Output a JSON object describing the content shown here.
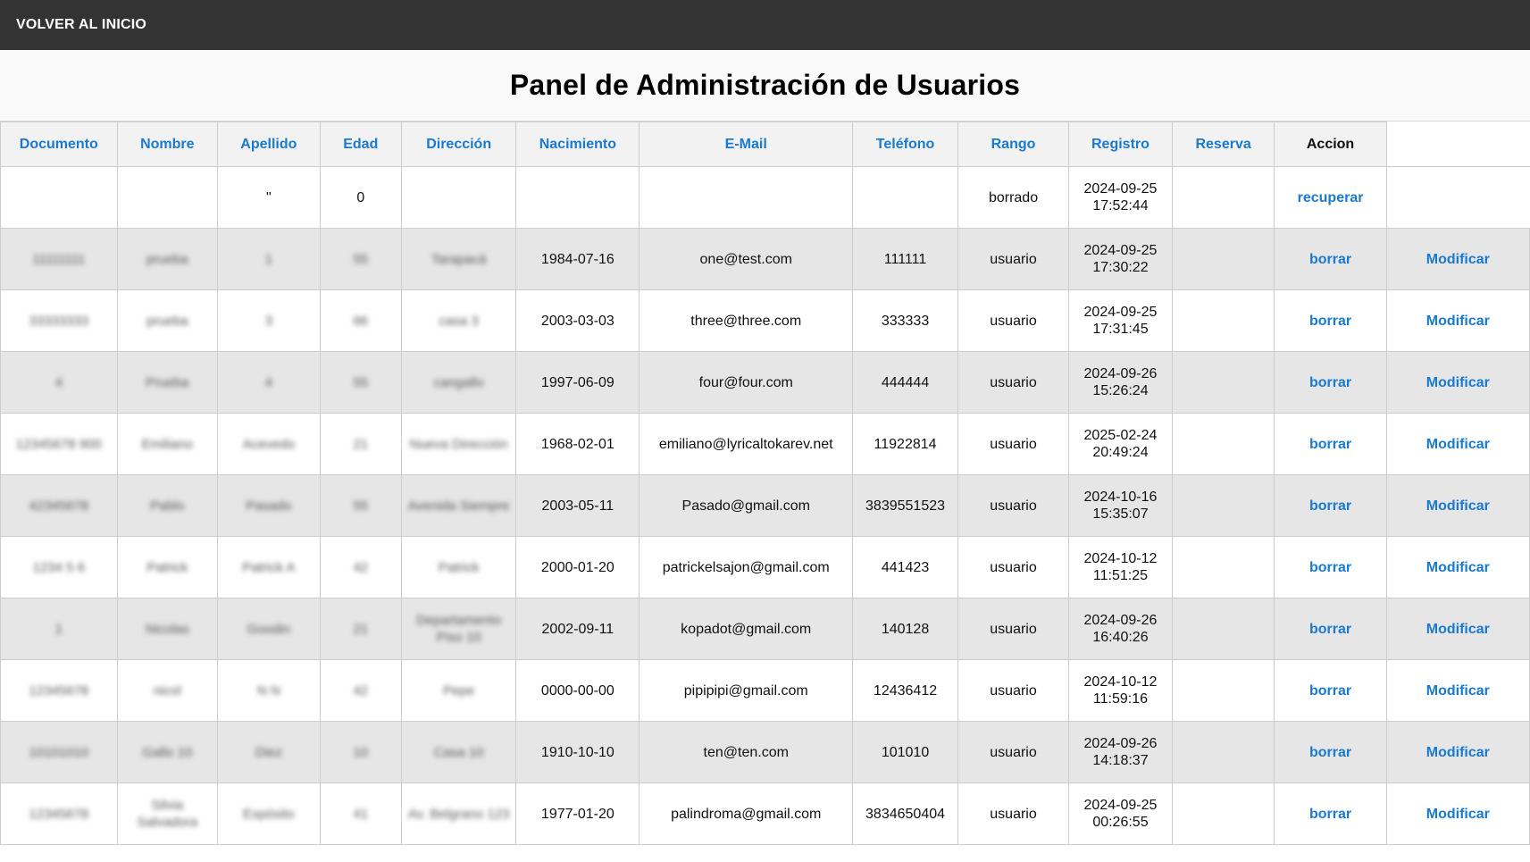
{
  "nav": {
    "back_label": "VOLVER AL INICIO"
  },
  "page": {
    "title": "Panel de Administración de Usuarios"
  },
  "table": {
    "headers": [
      "Documento",
      "Nombre",
      "Apellido",
      "Edad",
      "Dirección",
      "Nacimiento",
      "E-Mail",
      "Teléfono",
      "Rango",
      "Registro",
      "Reserva",
      "Accion"
    ],
    "rows": [
      {
        "documento": "",
        "nombre": "",
        "apellido": "\"",
        "edad": "0",
        "direccion": "",
        "nacimiento": "",
        "email": "",
        "telefono": "",
        "rango": "borrado",
        "registro": "2024-09-25 17:52:44",
        "reserva": "",
        "action": "recuperar",
        "modify": ""
      },
      {
        "documento": "11111111",
        "nombre": "prueba",
        "apellido": "1",
        "edad": "55",
        "direccion": "Tarapacá",
        "nacimiento": "1984-07-16",
        "email": "one@test.com",
        "telefono": "111111",
        "rango": "usuario",
        "registro": "2024-09-25 17:30:22",
        "reserva": "",
        "action": "borrar",
        "modify": "Modificar"
      },
      {
        "documento": "33333333",
        "nombre": "prueba",
        "apellido": "3",
        "edad": "66",
        "direccion": "casa 3",
        "nacimiento": "2003-03-03",
        "email": "three@three.com",
        "telefono": "333333",
        "rango": "usuario",
        "registro": "2024-09-25 17:31:45",
        "reserva": "",
        "action": "borrar",
        "modify": "Modificar"
      },
      {
        "documento": "4",
        "nombre": "Prueba",
        "apellido": "4",
        "edad": "55",
        "direccion": "cangallo",
        "nacimiento": "1997-06-09",
        "email": "four@four.com",
        "telefono": "444444",
        "rango": "usuario",
        "registro": "2024-09-26 15:26:24",
        "reserva": "",
        "action": "borrar",
        "modify": "Modificar"
      },
      {
        "documento": "12345678 900",
        "nombre": "Emiliano",
        "apellido": "Acevedo",
        "edad": "21",
        "direccion": "Nueva Dirección",
        "nacimiento": "1968-02-01",
        "email": "emiliano@lyricaltokarev.net",
        "telefono": "11922814",
        "rango": "usuario",
        "registro": "2025-02-24 20:49:24",
        "reserva": "",
        "action": "borrar",
        "modify": "Modificar"
      },
      {
        "documento": "42345678",
        "nombre": "Pablo",
        "apellido": "Pasado",
        "edad": "55",
        "direccion": "Avenida Siempre",
        "nacimiento": "2003-05-11",
        "email": "Pasado@gmail.com",
        "telefono": "3839551523",
        "rango": "usuario",
        "registro": "2024-10-16 15:35:07",
        "reserva": "",
        "action": "borrar",
        "modify": "Modificar"
      },
      {
        "documento": "1234 5 6",
        "nombre": "Patrick",
        "apellido": "Patrick A",
        "edad": "42",
        "direccion": "Patrick",
        "nacimiento": "2000-01-20",
        "email": "patrickelsajon@gmail.com",
        "telefono": "441423",
        "rango": "usuario",
        "registro": "2024-10-12 11:51:25",
        "reserva": "",
        "action": "borrar",
        "modify": "Modificar"
      },
      {
        "documento": "1",
        "nombre": "Nicolas",
        "apellido": "Goodin",
        "edad": "21",
        "direccion": "Departamento Piso 10",
        "nacimiento": "2002-09-11",
        "email": "kopadot@gmail.com",
        "telefono": "140128",
        "rango": "usuario",
        "registro": "2024-09-26 16:40:26",
        "reserva": "",
        "action": "borrar",
        "modify": "Modificar"
      },
      {
        "documento": "12345678",
        "nombre": "nicol",
        "apellido": "N N",
        "edad": "42",
        "direccion": "Pepe",
        "nacimiento": "0000-00-00",
        "email": "pipipipi@gmail.com",
        "telefono": "12436412",
        "rango": "usuario",
        "registro": "2024-10-12 11:59:16",
        "reserva": "",
        "action": "borrar",
        "modify": "Modificar"
      },
      {
        "documento": "10101010",
        "nombre": "Gallo 10",
        "apellido": "Diez",
        "edad": "10",
        "direccion": "Casa 10",
        "nacimiento": "1910-10-10",
        "email": "ten@ten.com",
        "telefono": "101010",
        "rango": "usuario",
        "registro": "2024-09-26 14:18:37",
        "reserva": "",
        "action": "borrar",
        "modify": "Modificar"
      },
      {
        "documento": "12345678",
        "nombre": "Silvia Salvadora",
        "apellido": "Expósito",
        "edad": "41",
        "direccion": "Av. Belgrano 123",
        "nacimiento": "1977-01-20",
        "email": "palindroma@gmail.com",
        "telefono": "3834650404",
        "rango": "usuario",
        "registro": "2024-09-25 00:26:55",
        "reserva": "",
        "action": "borrar",
        "modify": "Modificar"
      }
    ]
  }
}
